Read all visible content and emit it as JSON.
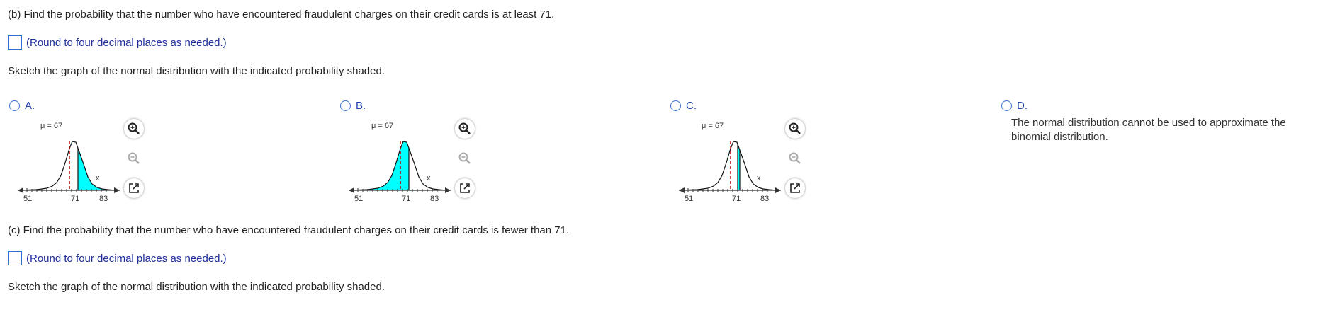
{
  "part_b": {
    "question": "(b) Find the probability that the number who have encountered fraudulent charges on their credit cards is at least 71.",
    "hint": "(Round to four decimal places as needed.)",
    "sketch_instruction": "Sketch the graph of the normal distribution with the indicated probability shaded.",
    "options": [
      {
        "label": "A.",
        "mu_label": "μ = 67",
        "ticks": [
          "51",
          "71",
          "83"
        ],
        "x_label": "x"
      },
      {
        "label": "B.",
        "mu_label": "μ = 67",
        "ticks": [
          "51",
          "71",
          "83"
        ],
        "x_label": "x"
      },
      {
        "label": "C.",
        "mu_label": "μ = 67",
        "ticks": [
          "51",
          "71",
          "83"
        ],
        "x_label": "x"
      },
      {
        "label": "D.",
        "text": "The normal distribution cannot be used to approximate the binomial distribution."
      }
    ]
  },
  "part_c": {
    "question": "(c) Find the probability that the number who have encountered fraudulent charges on their credit cards is fewer than 71.",
    "hint": "(Round to four decimal places as needed.)",
    "sketch_instruction": "Sketch the graph of the normal distribution with the indicated probability shaded."
  },
  "colors": {
    "shade": "#00ffff",
    "mean_line": "#c00000",
    "option_label": "#1f3fa8",
    "hint_text": "#1f2f9c",
    "input_border": "#2f6fd6"
  },
  "icons": {
    "zoom_in": "zoom-in-icon",
    "zoom_out": "zoom-out-icon",
    "popout": "open-new-window-icon"
  }
}
